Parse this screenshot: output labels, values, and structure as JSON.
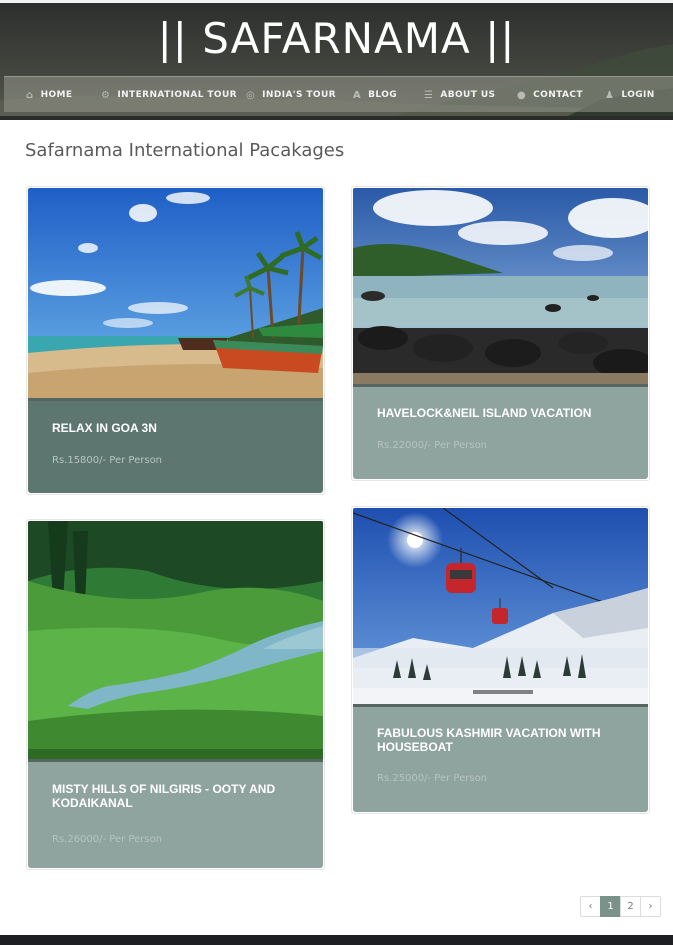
{
  "site": {
    "title": "|| SAFARNAMA ||"
  },
  "nav": {
    "items": [
      {
        "label": "HOME",
        "icon": "home-icon"
      },
      {
        "label": "INTERNATIONAL TOUR",
        "icon": "gears-icon"
      },
      {
        "label": "INDIA'S TOUR",
        "icon": "globe-icon"
      },
      {
        "label": "BLOG",
        "icon": "font-icon"
      },
      {
        "label": "ABOUT US",
        "icon": "list-icon"
      },
      {
        "label": "CONTACT",
        "icon": "chat-icon"
      },
      {
        "label": "LOGIN",
        "icon": "user-icon"
      }
    ]
  },
  "main": {
    "section_title": "Safarnama International Pacakages",
    "packages": [
      {
        "title": "RELAX IN GOA 3N",
        "price": "Rs.15800/- Per Person",
        "image": "goa-beach-image",
        "body_color": "#5d7670"
      },
      {
        "title": "HAVELOCK&NEIL ISLAND VACATION",
        "price": "Rs.22000/- Per Person",
        "image": "havelock-beach-image",
        "body_color": "#8fa39f"
      },
      {
        "title": "MISTY HILLS OF NILGIRIS - OOTY AND KODAIKANAL",
        "price": "Rs.26000/- Per Person",
        "image": "ooty-hills-image",
        "body_color": "#8fa39f"
      },
      {
        "title": "FABULOUS KASHMIR VACATION WITH HOUSEBOAT",
        "price": "Rs.25000/- Per Person",
        "image": "kashmir-gondola-image",
        "body_color": "#8fa39f"
      }
    ]
  },
  "pagination": {
    "prev": "‹",
    "pages": [
      "1",
      "2"
    ],
    "next": "›",
    "current": "1"
  }
}
